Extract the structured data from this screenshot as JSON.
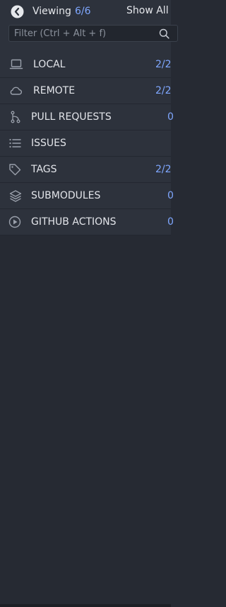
{
  "header": {
    "viewing_label": "Viewing",
    "viewing_count": "6/6",
    "show_all_label": "Show All"
  },
  "filter": {
    "placeholder": "Filter (Ctrl + Alt + f)"
  },
  "sections": [
    {
      "label": "LOCAL",
      "count": "2/2",
      "icon": "laptop-icon"
    },
    {
      "label": "REMOTE",
      "count": "2/2",
      "icon": "cloud-icon"
    },
    {
      "label": "PULL REQUESTS",
      "count": "0",
      "icon": "pull-request-icon"
    },
    {
      "label": "ISSUES",
      "count": "",
      "icon": "list-icon"
    },
    {
      "label": "TAGS",
      "count": "2/2",
      "icon": "tag-icon"
    },
    {
      "label": "SUBMODULES",
      "count": "0",
      "icon": "layers-icon"
    },
    {
      "label": "GITHUB ACTIONS",
      "count": "0",
      "icon": "play-circle-icon"
    }
  ],
  "colors": {
    "accent": "#7fa7ff",
    "panel": "#2d323c",
    "background": "#262a33"
  }
}
